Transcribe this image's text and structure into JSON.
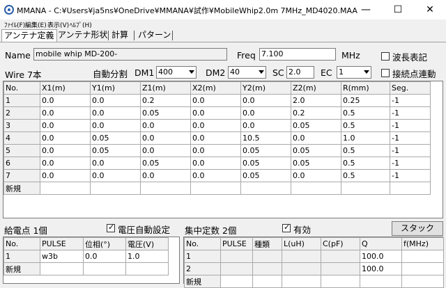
{
  "window": {
    "title": "MMANA - C:¥Users¥ja5ns¥OneDrive¥MMANA¥試作¥MobileWhip2.0m 7MHz_MD4020.MAA",
    "minimize": "—",
    "maximize": "☐",
    "close": "✕"
  },
  "menu": [
    "ﾌｧｲﾙ(F)",
    "編集(E)",
    "表示(V)",
    "ﾍﾙﾌﾟ(H)"
  ],
  "tabs": [
    "アンテナ定義",
    "アンテナ形状",
    "計算",
    "パターン"
  ],
  "antenna": {
    "name_label": "Name",
    "name_value": "mobile whip  MD-200-",
    "freq_label": "Freq",
    "freq_value": "7.100",
    "freq_unit": "MHz",
    "wavelength_label": "波長表記",
    "wire_count_label": "Wire 7本",
    "auto_split_label": "自動分割",
    "dm1_label": "DM1",
    "dm1_value": "400",
    "dm2_label": "DM2",
    "dm2_value": "40",
    "sc_label": "SC",
    "sc_value": "2.0",
    "ec_label": "EC",
    "ec_value": "1",
    "connect_label": "接続点連動"
  },
  "wires": {
    "columns": [
      "No.",
      "X1(m)",
      "Y1(m)",
      "Z1(m)",
      "X2(m)",
      "Y2(m)",
      "Z2(m)",
      "R(mm)",
      "Seg."
    ],
    "rows": [
      [
        "1",
        "0.0",
        "0.0",
        "0.2",
        "0.0",
        "0.0",
        "2.0",
        "0.25",
        "-1"
      ],
      [
        "2",
        "0.0",
        "0.0",
        "0.05",
        "0.0",
        "0.0",
        "0.2",
        "0.5",
        "-1"
      ],
      [
        "3",
        "0.0",
        "0.0",
        "0.0",
        "0.0",
        "0.0",
        "0.05",
        "0.5",
        "-1"
      ],
      [
        "4",
        "0.0",
        "0.05",
        "0.0",
        "0.0",
        "10.5",
        "0.0",
        "1.0",
        "-1"
      ],
      [
        "5",
        "0.0",
        "0.05",
        "0.0",
        "0.0",
        "0.05",
        "0.05",
        "0.5",
        "-1"
      ],
      [
        "6",
        "0.0",
        "0.0",
        "0.05",
        "0.0",
        "0.05",
        "0.05",
        "0.5",
        "-1"
      ],
      [
        "7",
        "0.0",
        "0.0",
        "0.0",
        "0.0",
        "0.05",
        "0.0",
        "0.5",
        "-1"
      ]
    ],
    "new_label": "新規"
  },
  "feed": {
    "title": "給電点 1個",
    "auto_voltage_label": "電圧自動設定",
    "columns": [
      "No.",
      "PULSE",
      "位相(°)",
      "電圧(V)"
    ],
    "rows": [
      [
        "1",
        "w3b",
        "0.0",
        "1.0"
      ]
    ],
    "new_label": "新規"
  },
  "loads": {
    "title": "集中定数 2個",
    "enabled_label": "有効",
    "stack_button": "スタック",
    "columns": [
      "No.",
      "PULSE",
      "種類",
      "L(uH)",
      "C(pF)",
      "Q",
      "f(MHz)"
    ],
    "rows": [
      [
        "1",
        "",
        "",
        "",
        "",
        "100.0",
        ""
      ],
      [
        "2",
        "",
        "",
        "",
        "",
        "100.0",
        ""
      ]
    ],
    "new_label": "新規"
  }
}
